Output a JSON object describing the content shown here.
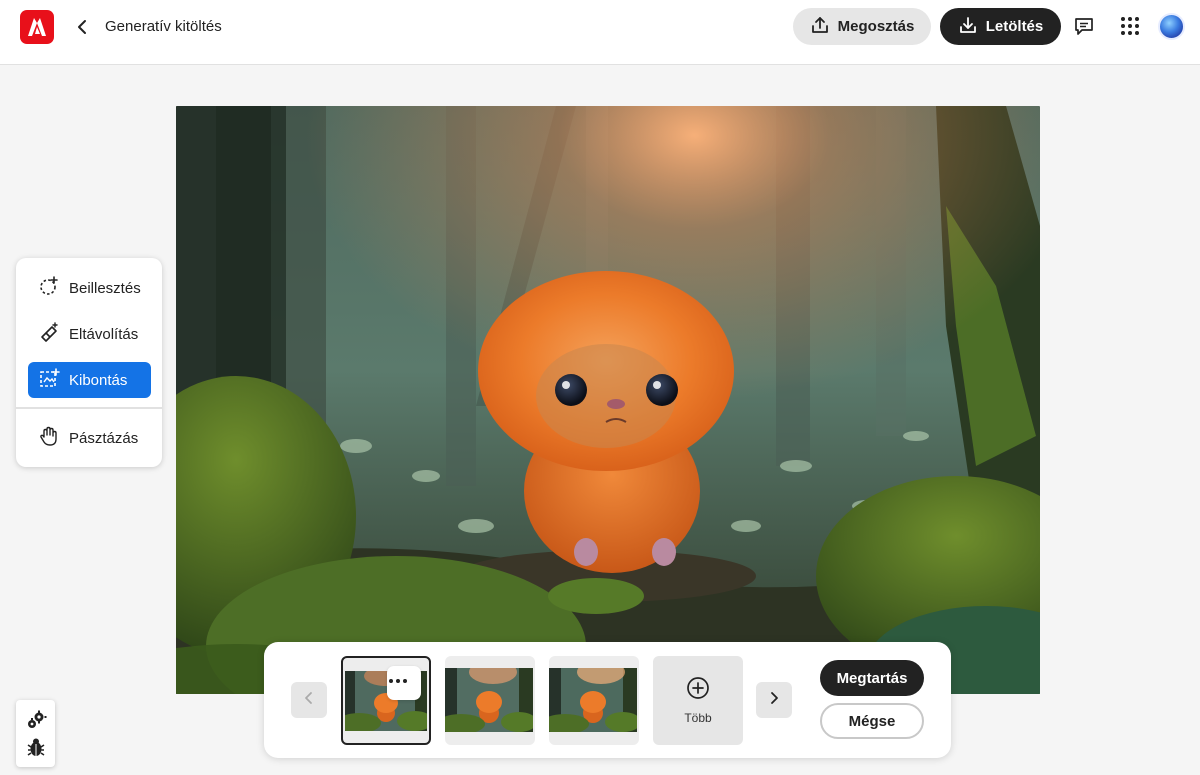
{
  "header": {
    "title": "Generatív kitöltés",
    "share_label": "Megosztás",
    "download_label": "Letöltés",
    "icons": [
      "adobe-logo-icon",
      "back-arrow-icon",
      "share-icon",
      "download-icon",
      "comment-icon",
      "apps-grid-icon",
      "avatar"
    ]
  },
  "tools": {
    "items": [
      {
        "label": "Beillesztés",
        "icon": "insert-icon",
        "active": false
      },
      {
        "label": "Eltávolítás",
        "icon": "remove-icon",
        "active": false
      },
      {
        "label": "Kibontás",
        "icon": "expand-icon",
        "active": true
      },
      {
        "label": "Pásztázás",
        "icon": "pan-hand-icon",
        "active": false
      }
    ]
  },
  "variations": {
    "more_label": "Több",
    "keep_label": "Megtartás",
    "cancel_label": "Mégse",
    "selected_index": 0,
    "count": 3
  },
  "colors": {
    "accent": "#1473e6",
    "adobe_red": "#e8101a",
    "dark_button": "#222222"
  }
}
